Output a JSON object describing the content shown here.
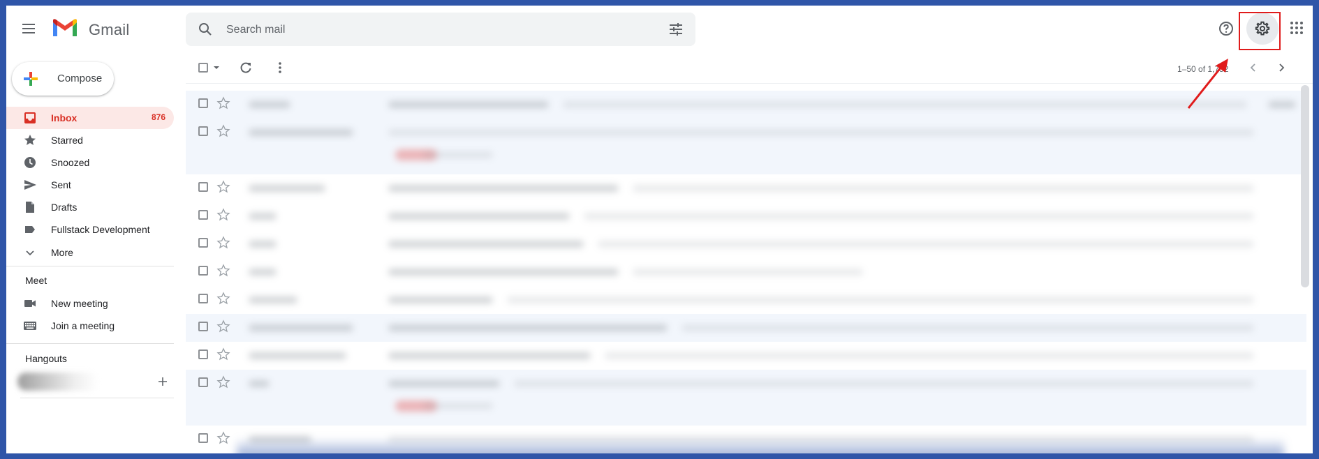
{
  "header": {
    "brand": "Gmail",
    "search_placeholder": "Search mail"
  },
  "sidebar": {
    "compose_label": "Compose",
    "items": [
      {
        "label": "Inbox",
        "count": "876",
        "icon": "inbox-icon"
      },
      {
        "label": "Starred",
        "icon": "star-icon"
      },
      {
        "label": "Snoozed",
        "icon": "clock-icon"
      },
      {
        "label": "Sent",
        "icon": "send-icon"
      },
      {
        "label": "Drafts",
        "icon": "draft-icon"
      },
      {
        "label": "Fullstack Development",
        "icon": "label-icon"
      },
      {
        "label": "More",
        "icon": "chevron-down-icon"
      }
    ],
    "meet": {
      "title": "Meet",
      "items": [
        {
          "label": "New meeting",
          "icon": "video-icon"
        },
        {
          "label": "Join a meeting",
          "icon": "keyboard-icon"
        }
      ]
    },
    "hangouts": {
      "title": "Hangouts"
    }
  },
  "toolbar": {
    "pagination": "1–50 of 1,752"
  },
  "colors": {
    "accent_red": "#d93025",
    "inbox_bg": "#fce8e6",
    "frame_blue": "#2f55a8",
    "highlight_box": "#e01b1b"
  }
}
